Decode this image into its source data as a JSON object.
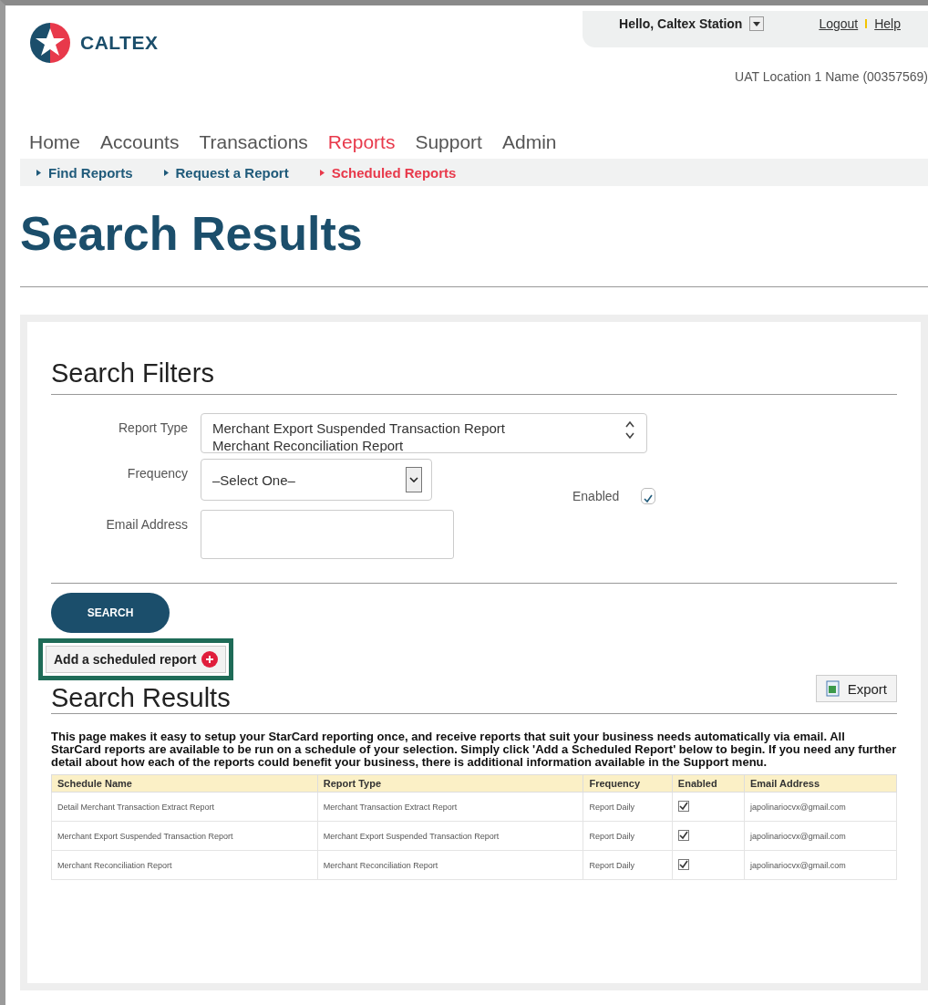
{
  "header": {
    "brand": "CALTEX",
    "greeting": "Hello, Caltex Station",
    "links": [
      "Logout",
      "Help"
    ],
    "location": "UAT Location 1 Name (00357569)"
  },
  "nav": [
    {
      "label": "Home",
      "selected": false
    },
    {
      "label": "Accounts",
      "selected": false
    },
    {
      "label": "Transactions",
      "selected": false
    },
    {
      "label": "Reports",
      "selected": true
    },
    {
      "label": "Support",
      "selected": false
    },
    {
      "label": "Admin",
      "selected": false
    }
  ],
  "subnav": [
    {
      "label": "Find Reports",
      "selected": false
    },
    {
      "label": "Request a Report",
      "selected": false
    },
    {
      "label": "Scheduled Reports",
      "selected": true
    }
  ],
  "page_title": "Search Results",
  "filters": {
    "title": "Search Filters",
    "report_type": {
      "label": "Report Type",
      "options": [
        "Merchant Export Suspended Transaction Report",
        "Merchant Reconciliation Report"
      ]
    },
    "frequency": {
      "label": "Frequency",
      "value": "–Select One–"
    },
    "email": {
      "label": "Email Address"
    },
    "enabled": {
      "label": "Enabled",
      "checked": true
    },
    "search_button": "SEARCH"
  },
  "add_button": "Add a scheduled report",
  "results": {
    "title": "Search Results",
    "export_button": "Export",
    "description": "This page makes it easy to setup your StarCard reporting once, and receive reports that suit your business needs automatically via email. All StarCard reports are available to be run on a schedule of your selection. Simply click 'Add a Scheduled Report' below to begin. If you need any further detail about how each of the reports could benefit your business, there is additional information available in the Support menu.",
    "columns": [
      "Schedule Name",
      "Report Type",
      "Frequency",
      "Enabled",
      "Email Address"
    ],
    "rows": [
      {
        "schedule_name": "Detail Merchant Transaction Extract Report",
        "report_type": "Merchant Transaction Extract Report",
        "frequency": "Report Daily",
        "enabled": true,
        "email": "japolinariocvx@gmail.com"
      },
      {
        "schedule_name": "Merchant Export Suspended Transaction Report",
        "report_type": "Merchant Export Suspended Transaction Report",
        "frequency": "Report Daily",
        "enabled": true,
        "email": "japolinariocvx@gmail.com"
      },
      {
        "schedule_name": "Merchant Reconciliation Report",
        "report_type": "Merchant Reconciliation Report",
        "frequency": "Report Daily",
        "enabled": true,
        "email": "japolinariocvx@gmail.com"
      }
    ]
  }
}
